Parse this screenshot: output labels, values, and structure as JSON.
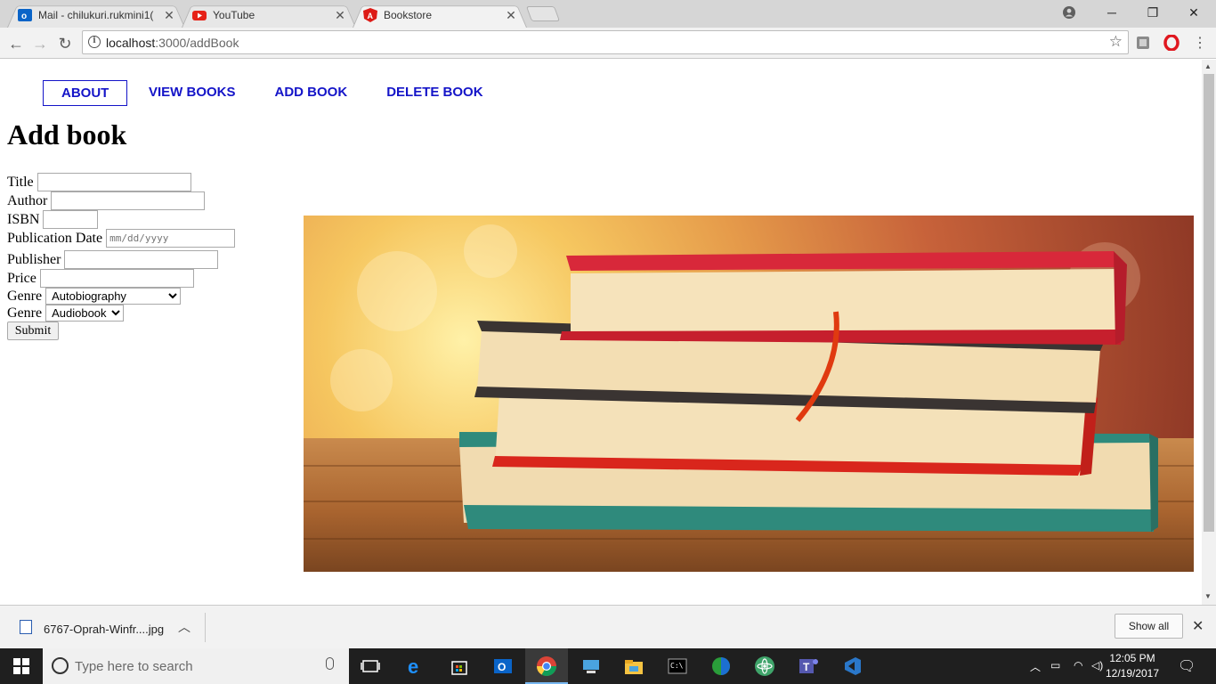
{
  "browser": {
    "tabs": [
      {
        "title": "Mail - chilukuri.rukmini1(",
        "favicon": "outlook-icon"
      },
      {
        "title": "YouTube",
        "favicon": "youtube-icon"
      },
      {
        "title": "Bookstore",
        "favicon": "angular-icon",
        "active": true
      }
    ],
    "url_host": "localhost",
    "url_path": ":3000/addBook"
  },
  "nav": {
    "items": [
      "ABOUT",
      "VIEW BOOKS",
      "ADD BOOK",
      "DELETE BOOK"
    ]
  },
  "page": {
    "heading": "Add book",
    "form": {
      "title_label": "Title",
      "author_label": "Author",
      "isbn_label": "ISBN",
      "pubdate_label": "Publication Date",
      "pubdate_placeholder": "mm/dd/yyyy",
      "publisher_label": "Publisher",
      "price_label": "Price",
      "genre_label": "Genre",
      "genre1_value": "Autobiography",
      "genre2_label": "Genre",
      "genre2_value": "Audiobook",
      "submit_label": "Submit"
    }
  },
  "downloads": {
    "filename": "6767-Oprah-Winfr....jpg",
    "show_all": "Show all"
  },
  "taskbar": {
    "search_placeholder": "Type here to search",
    "time": "12:05 PM",
    "date": "12/19/2017"
  },
  "colors": {
    "nav_link": "#1414c8",
    "taskbar_bg": "#1f1f1f"
  }
}
